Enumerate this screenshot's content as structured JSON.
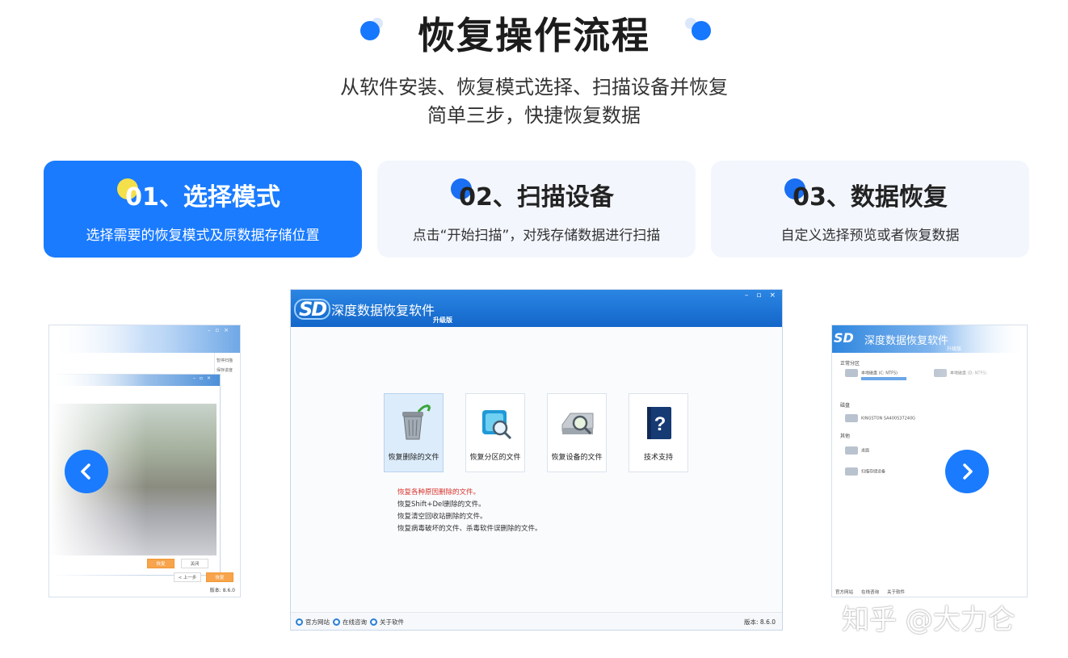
{
  "header": {
    "title": "恢复操作流程",
    "subtitle_line1": "从软件安装、恢复模式选择、扫描设备并恢复",
    "subtitle_line2": "简单三步，快捷恢复数据"
  },
  "steps": [
    {
      "title": "01、选择模式",
      "desc": "选择需要的恢复模式及原数据存储位置",
      "active": true
    },
    {
      "title": "02、扫描设备",
      "desc": "点击“开始扫描”，对残存储数据进行扫描",
      "active": false
    },
    {
      "title": "03、数据恢复",
      "desc": "自定义选择预览或者恢复数据",
      "active": false
    }
  ],
  "app": {
    "logo": "SD",
    "name": "深度数据恢复软件",
    "edition": "升级版",
    "window_controls": [
      "–",
      "▫",
      "×"
    ],
    "tiles": [
      {
        "label": "恢复删除的文件",
        "icon": "recycle-bin-icon",
        "selected": true
      },
      {
        "label": "恢复分区的文件",
        "icon": "partition-scan-icon",
        "selected": false
      },
      {
        "label": "恢复设备的文件",
        "icon": "device-scan-icon",
        "selected": false
      },
      {
        "label": "技术支持",
        "icon": "help-book-icon",
        "selected": false
      }
    ],
    "description": [
      "恢复各种原因删除的文件。",
      "恢复Shift+Del删除的文件。",
      "恢复清空回收站删除的文件。",
      "恢复病毒破坏的文件、杀毒软件误删除的文件。"
    ],
    "status_bar": {
      "links": [
        "官方网站",
        "在线咨询",
        "关于软件"
      ],
      "version": "版本: 8.6.0"
    }
  },
  "side_left": {
    "right_panel": [
      "暂停扫描",
      "保存进度"
    ],
    "buttons": [
      "恢复",
      "关闭"
    ],
    "footer_buttons": [
      "< 上一步",
      "恢复"
    ],
    "version": "版本: 8.6.0"
  },
  "side_right": {
    "name": "深度数据恢复软件",
    "edition": "升级版",
    "sections": [
      "正常分区",
      "磁盘",
      "其他"
    ],
    "drives": [
      "本地磁盘 (C: NTFS)",
      "本地磁盘 (D: NTFS)",
      "KINGSTON SA400S37240G",
      "桌面",
      "扫描存储设备"
    ],
    "status_bar": [
      "官方网站",
      "在线咨询",
      "关于软件"
    ]
  },
  "watermark": "知乎 @大力仑",
  "colors": {
    "accent": "#1a7bff",
    "step_dot_active": "#f4e04a",
    "card_bg": "#f3f6fd",
    "app_titlebar": "#1f76d6",
    "warning_red": "#d8342d"
  }
}
